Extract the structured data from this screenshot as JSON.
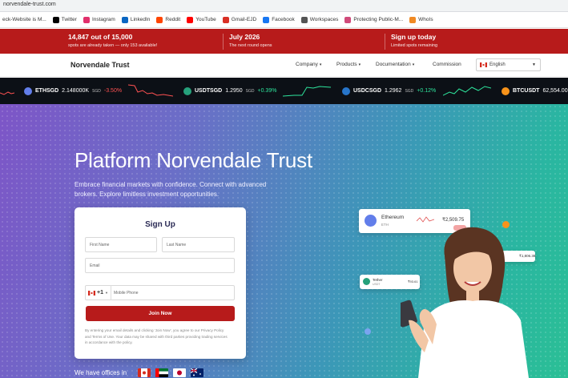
{
  "browser": {
    "url": "norvendale-trust.com",
    "bookmarks": [
      {
        "label": "eck-Website is M...",
        "icon": "bookmark-icon",
        "color": "#4b7bd6"
      },
      {
        "label": "Twitter",
        "icon": "x-icon",
        "color": "#000000"
      },
      {
        "label": "Instagram",
        "icon": "instagram-icon",
        "color": "#e1306c"
      },
      {
        "label": "LinkedIn",
        "icon": "linkedin-icon",
        "color": "#0a66c2"
      },
      {
        "label": "Reddit",
        "icon": "reddit-icon",
        "color": "#ff4500"
      },
      {
        "label": "YouTube",
        "icon": "youtube-icon",
        "color": "#ff0000"
      },
      {
        "label": "Gmail-EJD",
        "icon": "gmail-icon",
        "color": "#d93025"
      },
      {
        "label": "Facebook",
        "icon": "facebook-icon",
        "color": "#1877f2"
      },
      {
        "label": "Workspaces",
        "icon": "workspaces-icon",
        "color": "#555555"
      },
      {
        "label": "Protecting Public-M...",
        "icon": "bookmark-icon",
        "color": "#d04a7a"
      },
      {
        "label": "WhoIs",
        "icon": "whois-icon",
        "color": "#f08a24"
      }
    ]
  },
  "promo": {
    "items": [
      {
        "title": "14,847 out of 15,000",
        "sub": "spots are already taken — only 153 available!"
      },
      {
        "title": "July 2026",
        "sub": "The next round opens"
      },
      {
        "title": "Sign up today",
        "sub": "Limited spots remaining"
      }
    ]
  },
  "nav": {
    "brand": "Norvendale Trust",
    "items": [
      "Company",
      "Products",
      "Documentation",
      "Commission"
    ],
    "language": "English"
  },
  "ticker": [
    {
      "symbol": "ETHSGD",
      "price": "2.148000K",
      "unit": "SGD",
      "change": "-3.50%",
      "dir": "neg",
      "color": "#627eea"
    },
    {
      "symbol": "USDTSGD",
      "price": "1.2950",
      "unit": "SGD",
      "change": "+0.39%",
      "dir": "pos",
      "color": "#26a17b"
    },
    {
      "symbol": "USDCSGD",
      "price": "1.2962",
      "unit": "SGD",
      "change": "+0.12%",
      "dir": "pos",
      "color": "#2775ca"
    },
    {
      "symbol": "BTCUSDT",
      "price": "62,554.00",
      "unit": "",
      "change": "",
      "dir": "pos",
      "color": "#f7931a"
    }
  ],
  "hero": {
    "title": "Platform Norvendale Trust",
    "lead": "Embrace financial markets with confidence. Connect with advanced brokers. Explore limitless investment opportunities."
  },
  "form": {
    "title": "Sign Up",
    "first_name": "First Name",
    "last_name": "Last Name",
    "email": "Email",
    "phone_code": "+1",
    "phone": "Mobile Phone",
    "join": "Join Now",
    "legal": "By entering your email details and clicking 'Join Now', you agree to our Privacy Policy and Terms of Use. Your data may be shared with third parties providing trading services in accordance with the policy."
  },
  "offices": {
    "label": "We have offices in"
  },
  "cards": {
    "eth": {
      "name": "Ethereum",
      "sym": "ETH",
      "price": "₹2,509.75"
    },
    "tether": {
      "name": "Tether",
      "sym": "USDT",
      "price": "₹93.61"
    },
    "mid": {
      "price": "₹1,806.38"
    }
  }
}
